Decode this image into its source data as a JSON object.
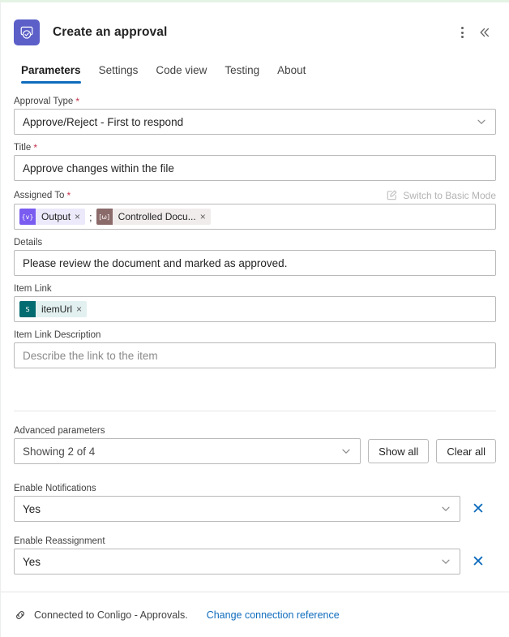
{
  "header": {
    "title": "Create an approval",
    "app_icon": "approval-app-icon",
    "more_menu_label": "More commands",
    "collapse_label": "Collapse"
  },
  "tabs": [
    {
      "label": "Parameters",
      "active": true
    },
    {
      "label": "Settings",
      "active": false
    },
    {
      "label": "Code view",
      "active": false
    },
    {
      "label": "Testing",
      "active": false
    },
    {
      "label": "About",
      "active": false
    }
  ],
  "form": {
    "approval_type": {
      "label": "Approval Type",
      "required": "*",
      "value": "Approve/Reject - First to respond"
    },
    "title": {
      "label": "Title",
      "required": "*",
      "value": "Approve changes within the file"
    },
    "assigned_to": {
      "label": "Assigned To",
      "required": "*",
      "basic_mode_link": "Switch to Basic Mode",
      "separator": ";",
      "tokens": [
        {
          "text": "Output",
          "icon": "dynamic-content-icon",
          "glyph": "{v}",
          "remove": "×"
        },
        {
          "text": "Controlled Docu...",
          "icon": "variable-icon",
          "glyph": "[ω]",
          "remove": "×"
        }
      ]
    },
    "details": {
      "label": "Details",
      "value": "Please review the document and marked as approved."
    },
    "item_link": {
      "label": "Item Link",
      "tokens": [
        {
          "text": "itemUrl",
          "icon": "sharepoint-icon",
          "glyph": "S",
          "remove": "×"
        }
      ]
    },
    "item_link_description": {
      "label": "Item Link Description",
      "placeholder": "Describe the link to the item",
      "value": ""
    }
  },
  "advanced": {
    "label": "Advanced parameters",
    "selector_value": "Showing 2 of 4",
    "show_all_label": "Show all",
    "clear_all_label": "Clear all",
    "fields": [
      {
        "label": "Enable Notifications",
        "value": "Yes",
        "remove": "✕"
      },
      {
        "label": "Enable Reassignment",
        "value": "Yes",
        "remove": "✕"
      }
    ]
  },
  "footer": {
    "icon": "connection-icon",
    "status": "Connected to Conligo - Approvals.",
    "link": "Change connection reference"
  },
  "colors": {
    "accent": "#0f6cbd",
    "app_icon_bg": "#5b5fc7",
    "required": "#c4314b",
    "top_border": "#e4f3e4"
  }
}
